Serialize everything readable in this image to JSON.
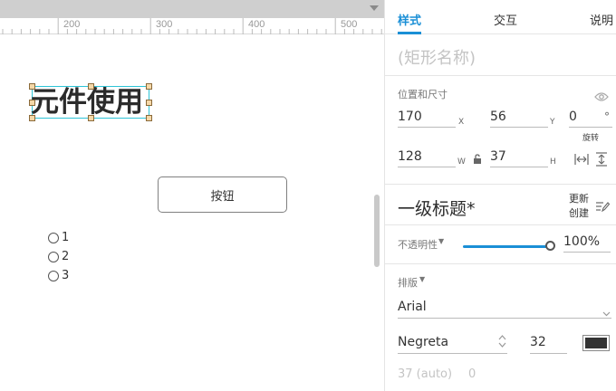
{
  "ruler": {
    "labels": [
      {
        "text": "200"
      },
      {
        "text": "300"
      },
      {
        "text": "400"
      },
      {
        "text": "500"
      }
    ]
  },
  "canvas": {
    "heading_text": "元件使用",
    "button_label": "按钮",
    "radio_items": [
      "1",
      "2",
      "3"
    ]
  },
  "panel": {
    "tabs": [
      {
        "label": "样式",
        "active": true
      },
      {
        "label": "交互",
        "active": false
      },
      {
        "label": "说明",
        "active": false
      }
    ],
    "name_placeholder": "(矩形名称)",
    "geometry": {
      "title": "位置和尺寸",
      "x_value": "170",
      "x_unit": "X",
      "y_value": "56",
      "y_unit": "Y",
      "rotation_value": "0",
      "rotation_unit": "°",
      "rotation_label": "旋转",
      "w_value": "128",
      "w_unit": "W",
      "h_value": "37",
      "h_unit": "H"
    },
    "style": {
      "name": "一级标题*",
      "update_label": "更新",
      "create_label": "创建"
    },
    "opacity": {
      "label": "不透明性",
      "value": "100%",
      "level": 1.0
    },
    "typography": {
      "title": "排版",
      "font_family": "Arial",
      "font_weight": "Negreta",
      "font_size": "32",
      "line_height": "37 (auto)",
      "letter_spacing": "0",
      "text_color": "#333333"
    }
  },
  "colors": {
    "accent": "#1a8fd6",
    "selection": "#2ec4d6"
  }
}
